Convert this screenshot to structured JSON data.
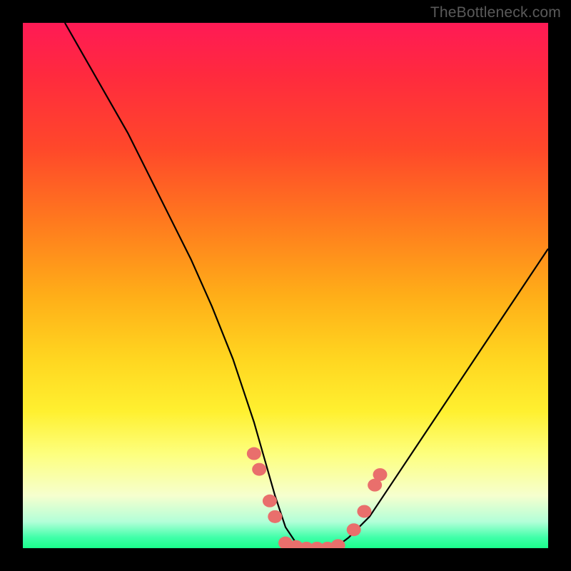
{
  "watermark": "TheBottleneck.com",
  "colors": {
    "frame": "#000000",
    "curve": "#000000",
    "marker_fill": "#e96f6c",
    "gradient_stops": [
      "#ff1a55",
      "#ff2a3e",
      "#ff482a",
      "#ff7a1e",
      "#ffae18",
      "#ffd620",
      "#fff030",
      "#fdff7d",
      "#f6ffce",
      "#b2ffd8",
      "#3fffa8",
      "#1aff8c"
    ]
  },
  "chart_data": {
    "type": "line",
    "title": "",
    "xlabel": "",
    "ylabel": "",
    "xlim": [
      0,
      100
    ],
    "ylim": [
      0,
      100
    ],
    "grid": false,
    "legend": false,
    "series": [
      {
        "name": "bottleneck-curve",
        "x": [
          8,
          12,
          16,
          20,
          24,
          28,
          32,
          36,
          40,
          42,
          44,
          46,
          48,
          50,
          52,
          54,
          56,
          58,
          60,
          62,
          66,
          70,
          74,
          78,
          82,
          86,
          90,
          94,
          98,
          100
        ],
        "y": [
          100,
          93,
          86,
          79,
          71,
          63,
          55,
          46,
          36,
          30,
          24,
          17,
          10,
          4,
          1,
          0,
          0,
          0,
          0.5,
          2,
          6,
          12,
          18,
          24,
          30,
          36,
          42,
          48,
          54,
          57
        ]
      }
    ],
    "markers": [
      {
        "name": "left-upper-dot",
        "x": 44,
        "y": 18
      },
      {
        "name": "left-upper-dot-2",
        "x": 45,
        "y": 15
      },
      {
        "name": "left-lower-dot",
        "x": 47,
        "y": 9
      },
      {
        "name": "left-lower-dot-2",
        "x": 48,
        "y": 6
      },
      {
        "name": "bottom-dot-1",
        "x": 50,
        "y": 1
      },
      {
        "name": "bottom-dot-2",
        "x": 52,
        "y": 0.3
      },
      {
        "name": "bottom-dot-3",
        "x": 54,
        "y": 0
      },
      {
        "name": "bottom-dot-4",
        "x": 56,
        "y": 0
      },
      {
        "name": "bottom-dot-5",
        "x": 58,
        "y": 0
      },
      {
        "name": "bottom-dot-6",
        "x": 60,
        "y": 0.5
      },
      {
        "name": "right-lower-dot",
        "x": 63,
        "y": 3.5
      },
      {
        "name": "right-mid-dot",
        "x": 65,
        "y": 7
      },
      {
        "name": "right-upper-dot",
        "x": 67,
        "y": 12
      },
      {
        "name": "right-upper-dot-2",
        "x": 68,
        "y": 14
      }
    ]
  }
}
